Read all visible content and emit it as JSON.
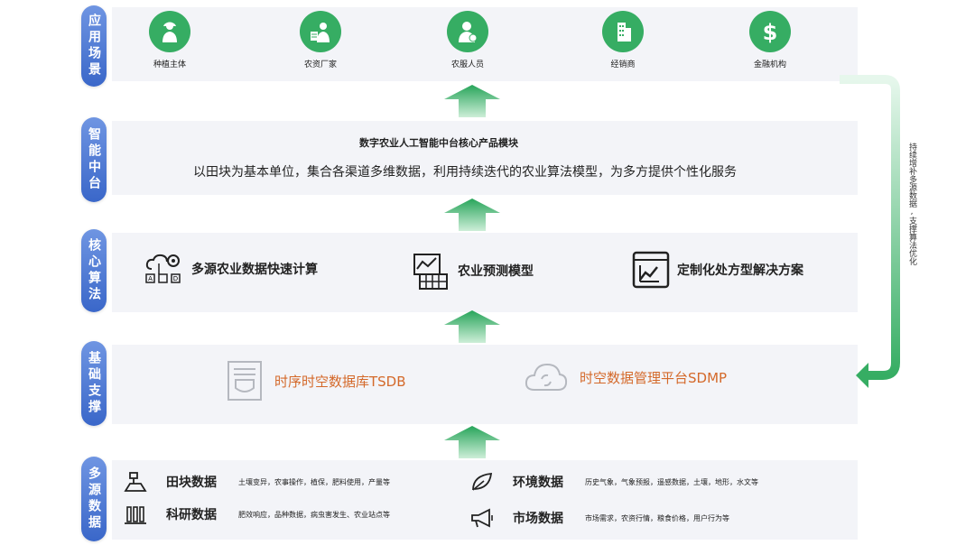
{
  "layers": {
    "application": "应用场景",
    "middle_platform": "智能中台",
    "core_algorithm": "核心算法",
    "infrastructure": "基础支撑",
    "multi_source": "多源数据"
  },
  "scenarios": [
    {
      "label": "种植主体",
      "icon": "farmer-icon"
    },
    {
      "label": "农资厂家",
      "icon": "agri-supplier-icon"
    },
    {
      "label": "农服人员",
      "icon": "service-staff-icon"
    },
    {
      "label": "经销商",
      "icon": "building-icon"
    },
    {
      "label": "金融机构",
      "icon": "dollar-icon"
    }
  ],
  "middle": {
    "title": "数字农业人工智能中台核心产品模块",
    "description": "以田块为基本单位，集合各渠道多维数据，利用持续迭代的农业算法模型，为多方提供个性化服务"
  },
  "algorithms": [
    {
      "label": "多源农业数据快速计算",
      "icon": "data-compute-icon"
    },
    {
      "label": "农业预测模型",
      "icon": "prediction-model-icon"
    },
    {
      "label": "定制化处方型解决方案",
      "icon": "solution-chart-icon"
    }
  ],
  "infrastructure_items": [
    {
      "label": "时序时空数据库TSDB",
      "icon": "database-icon"
    },
    {
      "label": "时空数据管理平台SDMP",
      "icon": "cloud-sync-icon"
    }
  ],
  "data_sources": [
    {
      "name": "田块数据",
      "desc": "土壤变异，农事操作，植保，肥料使用，产量等",
      "icon": "field-icon"
    },
    {
      "name": "科研数据",
      "desc": "肥效响应，品种数据，病虫害发生、农业站点等",
      "icon": "lab-icon"
    },
    {
      "name": "环境数据",
      "desc": "历史气象，气象预报，遥感数据，土壤，地形，水文等",
      "icon": "leaf-icon"
    },
    {
      "name": "市场数据",
      "desc": "市场需求，农资行情，粮食价格，用户行为等",
      "icon": "megaphone-icon"
    }
  ],
  "side_note": "持续增补多源数据,支撑算法优化",
  "colors": {
    "accent_green": "#36ad63",
    "label_blue": "#3a67c9",
    "orange": "#d4692a",
    "panel": "#f3f4f8"
  }
}
